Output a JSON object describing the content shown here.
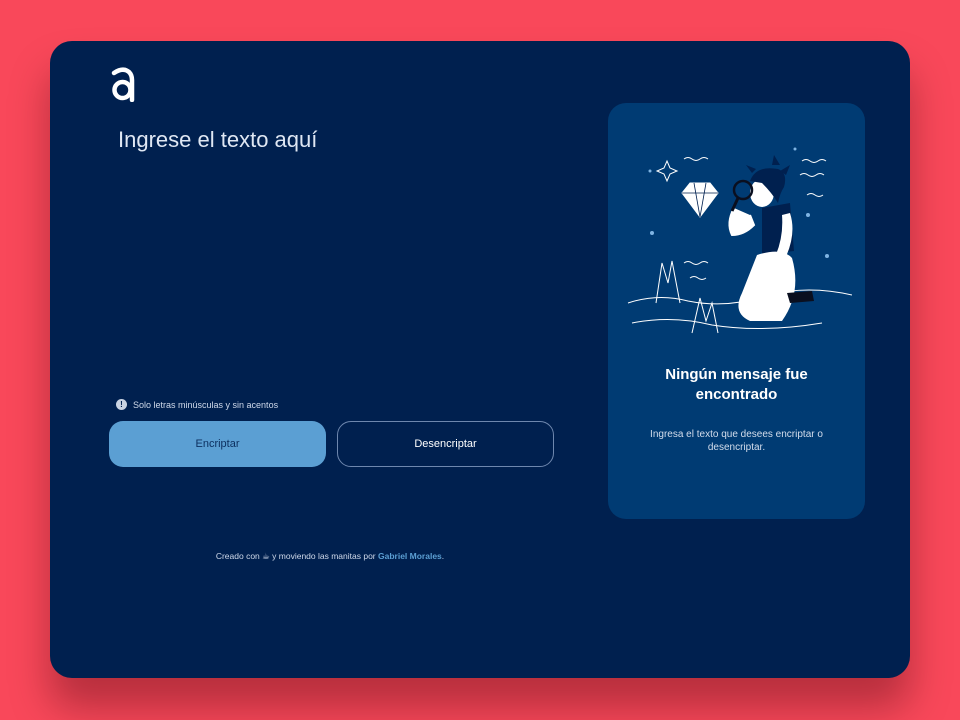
{
  "logo": {
    "icon": "alura-a-logo-icon"
  },
  "input": {
    "placeholder": "Ingrese el texto aquí",
    "value": ""
  },
  "hint": {
    "icon": "info-icon",
    "icon_glyph": "!",
    "text": "Solo letras minúsculas y sin acentos"
  },
  "buttons": {
    "encrypt_label": "Encriptar",
    "decrypt_label": "Desencriptar"
  },
  "output": {
    "illustration": "person-with-magnifying-glass-illustration",
    "title": "Ningún mensaje fue encontrado",
    "text": "Ingresa el texto que desees encriptar o desencriptar."
  },
  "footer": {
    "prefix": "Creado con",
    "icon": "coffee-icon",
    "icon_glyph": "☕",
    "middle": "y moviendo las manitas por",
    "author": "Gabriel Morales",
    "suffix": "."
  },
  "colors": {
    "background": "#f9485a",
    "panel": "#00204f",
    "card": "#003b73",
    "accent": "#5b9fd3"
  }
}
